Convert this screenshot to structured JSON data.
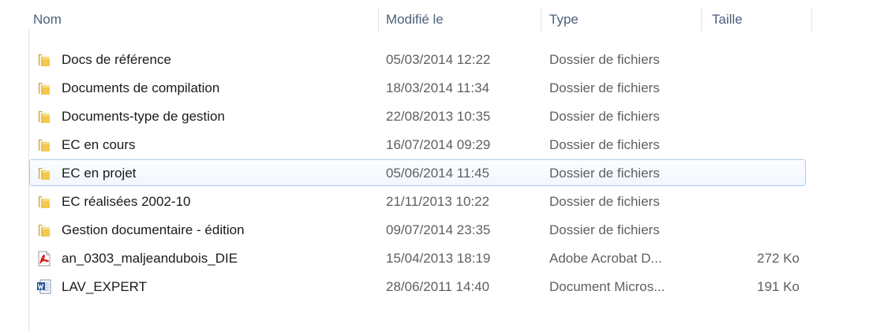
{
  "columns": {
    "name": "Nom",
    "modified": "Modifié le",
    "type": "Type",
    "size": "Taille"
  },
  "files": [
    {
      "name": "Docs de référence",
      "modified": "05/03/2014 12:22",
      "type": "Dossier de fichiers",
      "size": "",
      "icon": "folder-icon"
    },
    {
      "name": "Documents de compilation",
      "modified": "18/03/2014 11:34",
      "type": "Dossier de fichiers",
      "size": "",
      "icon": "folder-icon"
    },
    {
      "name": "Documents-type de gestion",
      "modified": "22/08/2013 10:35",
      "type": "Dossier de fichiers",
      "size": "",
      "icon": "folder-icon"
    },
    {
      "name": "EC en cours",
      "modified": "16/07/2014 09:29",
      "type": "Dossier de fichiers",
      "size": "",
      "icon": "folder-icon"
    },
    {
      "name": "EC en projet",
      "modified": "05/06/2014 11:45",
      "type": "Dossier de fichiers",
      "size": "",
      "icon": "folder-icon",
      "selected": true
    },
    {
      "name": "EC réalisées 2002-10",
      "modified": "21/11/2013 10:22",
      "type": "Dossier de fichiers",
      "size": "",
      "icon": "folder-icon"
    },
    {
      "name": "Gestion documentaire - édition",
      "modified": "09/07/2014 23:35",
      "type": "Dossier de fichiers",
      "size": "",
      "icon": "folder-icon"
    },
    {
      "name": "an_0303_maljeandubois_DIE",
      "modified": "15/04/2013 18:19",
      "type": "Adobe Acrobat D...",
      "size": "272 Ko",
      "icon": "pdf-icon"
    },
    {
      "name": "LAV_EXPERT",
      "modified": "28/06/2011 14:40",
      "type": "Document Micros...",
      "size": "191 Ko",
      "icon": "word-doc-icon"
    }
  ]
}
